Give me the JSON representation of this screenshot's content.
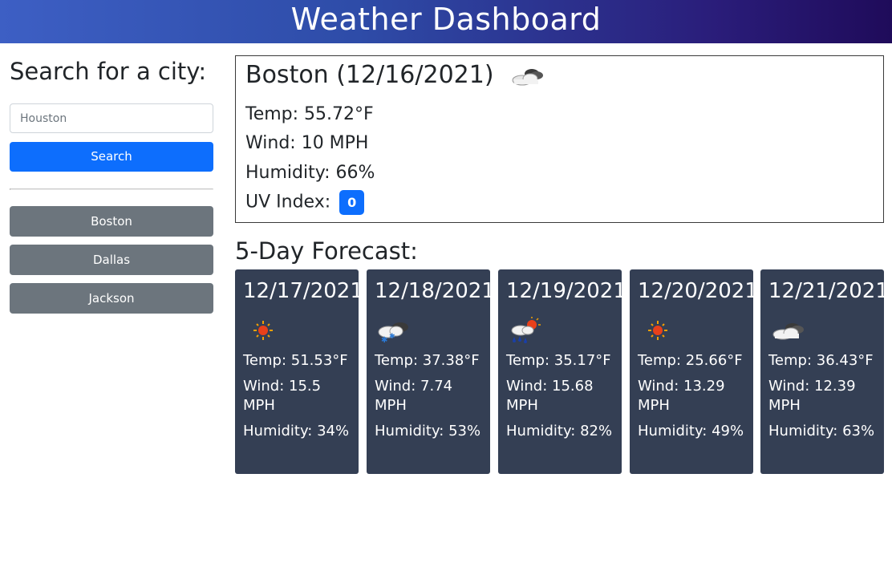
{
  "header": {
    "title": "Weather Dashboard"
  },
  "sidebar": {
    "heading": "Search for a city:",
    "search_value": "Houston",
    "search_button": "Search",
    "history": [
      "Boston",
      "Dallas",
      "Jackson"
    ]
  },
  "current": {
    "title": "Boston (12/16/2021)",
    "icon": "partly-cloudy-icon",
    "temp": "Temp: 55.72°F",
    "wind": "Wind: 10 MPH",
    "humidity": "Humidity: 66%",
    "uv_label": "UV Index:",
    "uv_value": "0",
    "uv_color": "#0d6efd"
  },
  "forecast": {
    "heading": "5-Day Forecast:",
    "days": [
      {
        "date": "12/17/2021",
        "icon": "sun-icon",
        "temp": "Temp: 51.53°F",
        "wind": "Wind: 15.5 MPH",
        "humidity": "Humidity: 34%"
      },
      {
        "date": "12/18/2021",
        "icon": "snow-cloud-icon",
        "temp": "Temp: 37.38°F",
        "wind": "Wind: 7.74 MPH",
        "humidity": "Humidity: 53%"
      },
      {
        "date": "12/19/2021",
        "icon": "rain-sun-icon",
        "temp": "Temp: 35.17°F",
        "wind": "Wind: 15.68 MPH",
        "humidity": "Humidity: 82%"
      },
      {
        "date": "12/20/2021",
        "icon": "sun-icon",
        "temp": "Temp: 25.66°F",
        "wind": "Wind: 13.29 MPH",
        "humidity": "Humidity: 49%"
      },
      {
        "date": "12/21/2021",
        "icon": "cloud-icon",
        "temp": "Temp: 36.43°F",
        "wind": "Wind: 12.39 MPH",
        "humidity": "Humidity: 63%"
      }
    ]
  },
  "colors": {
    "primary": "#0d6efd",
    "secondary": "#6c757d",
    "card_bg": "#343f54"
  }
}
